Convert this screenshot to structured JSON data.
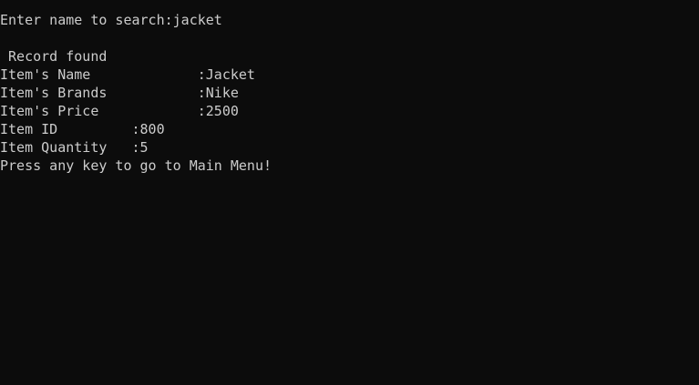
{
  "colors": {
    "background": "#0c0c0c",
    "text": "#cccccc"
  },
  "console": {
    "lines": [
      "Enter name to search:jacket",
      "",
      " Record found",
      "Item's Name             :Jacket",
      "Item's Brands           :Nike",
      "Item's Price            :2500",
      "Item ID         :800",
      "Item Quantity   :5",
      "Press any key to go to Main Menu!"
    ]
  }
}
